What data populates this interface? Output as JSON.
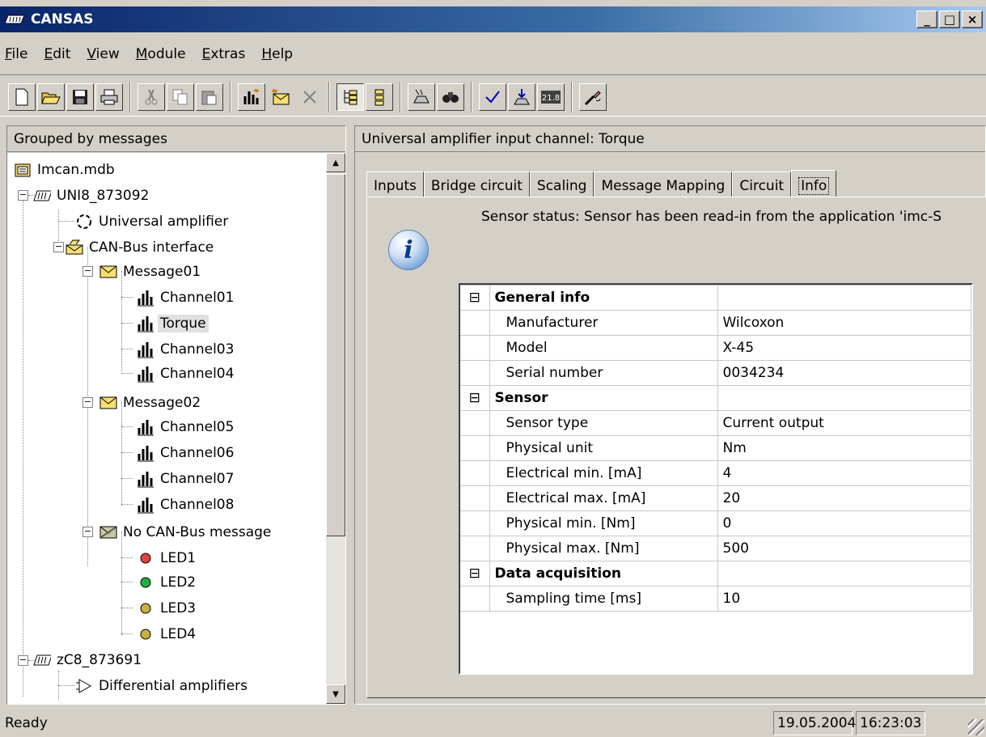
{
  "window": {
    "title": "CANSAS",
    "controls": {
      "minimize": "_",
      "maximize": "□",
      "close": "×"
    }
  },
  "menu": [
    {
      "key": "F",
      "rest": "ile"
    },
    {
      "key": "E",
      "rest": "dit"
    },
    {
      "key": "V",
      "rest": "iew"
    },
    {
      "key": "M",
      "rest": "odule"
    },
    {
      "key": "E",
      "rest": "xtras"
    },
    {
      "key": "H",
      "rest": "elp"
    }
  ],
  "toolbar": {
    "icons": [
      "new-icon",
      "open-icon",
      "save-icon",
      "print-icon",
      "cut-icon",
      "copy-icon",
      "paste-icon",
      "add-channel-icon",
      "add-message-icon",
      "delete-icon",
      "tree-view-icon",
      "list-view-icon",
      "integrate-icon",
      "find-icon",
      "check-icon",
      "download-icon",
      "measure-icon",
      "properties-icon"
    ]
  },
  "left_pane": {
    "header": "Grouped by messages",
    "tree": [
      {
        "label": "Imcan.mdb",
        "icon": "database-icon",
        "expander": ""
      },
      {
        "label": "UNI8_873092",
        "icon": "module-icon",
        "expander": "−"
      },
      {
        "label": "Universal amplifier",
        "icon": "amplifier-icon",
        "expander": ""
      },
      {
        "label": "CAN-Bus interface",
        "icon": "canbus-icon",
        "expander": "−"
      },
      {
        "label": "Message01",
        "icon": "message-icon",
        "expander": "−"
      },
      {
        "label": "Channel01",
        "icon": "channel-icon",
        "expander": ""
      },
      {
        "label": "Torque",
        "icon": "channel-icon",
        "expander": "",
        "selected": true
      },
      {
        "label": "Channel03",
        "icon": "channel-icon",
        "expander": ""
      },
      {
        "label": "Channel04",
        "icon": "channel-icon",
        "expander": ""
      },
      {
        "label": "Message02",
        "icon": "message-icon",
        "expander": "−"
      },
      {
        "label": "Channel05",
        "icon": "channel-icon",
        "expander": ""
      },
      {
        "label": "Channel06",
        "icon": "channel-icon",
        "expander": ""
      },
      {
        "label": "Channel07",
        "icon": "channel-icon",
        "expander": ""
      },
      {
        "label": "Channel08",
        "icon": "channel-icon",
        "expander": ""
      },
      {
        "label": "No CAN-Bus message",
        "icon": "no-message-icon",
        "expander": "−"
      },
      {
        "label": "LED1",
        "icon": "led-red-icon",
        "expander": ""
      },
      {
        "label": "LED2",
        "icon": "led-green-icon",
        "expander": ""
      },
      {
        "label": "LED3",
        "icon": "led-yellow-icon",
        "expander": ""
      },
      {
        "label": "LED4",
        "icon": "led-yellow-icon",
        "expander": ""
      },
      {
        "label": "zC8_873691",
        "icon": "module-icon",
        "expander": "−"
      },
      {
        "label": "Differential amplifiers",
        "icon": "diff-amplifier-icon",
        "expander": ""
      }
    ],
    "scroll_up": "▲",
    "scroll_down": "▼"
  },
  "right_pane": {
    "header": "Universal amplifier input channel: Torque",
    "tabs": [
      "Inputs",
      "Bridge circuit",
      "Scaling",
      "Message Mapping",
      "Circuit",
      "Info"
    ],
    "active_tab": "Info",
    "sensor_status": "Sensor status:  Sensor has been read-in from the application 'imc-S",
    "info_icon_glyph": "i",
    "grid": [
      {
        "type": "category",
        "toggle": "⊟",
        "key": "General info",
        "value": ""
      },
      {
        "type": "prop",
        "key": "Manufacturer",
        "value": "Wilcoxon"
      },
      {
        "type": "prop",
        "key": "Model",
        "value": "X-45"
      },
      {
        "type": "prop",
        "key": "Serial number",
        "value": "0034234"
      },
      {
        "type": "category",
        "toggle": "⊟",
        "key": "Sensor",
        "value": ""
      },
      {
        "type": "prop",
        "key": "Sensor type",
        "value": "Current output"
      },
      {
        "type": "prop",
        "key": "Physical unit",
        "value": "Nm"
      },
      {
        "type": "prop",
        "key": "Electrical min. [mA]",
        "value": "4"
      },
      {
        "type": "prop",
        "key": "Electrical max. [mA]",
        "value": "20"
      },
      {
        "type": "prop",
        "key": "Physical min. [Nm]",
        "value": "0"
      },
      {
        "type": "prop",
        "key": "Physical max. [Nm]",
        "value": "500"
      },
      {
        "type": "category",
        "toggle": "⊟",
        "key": "Data acquisition",
        "value": ""
      },
      {
        "type": "prop",
        "key": "Sampling time [ms]",
        "value": "10"
      }
    ]
  },
  "statusbar": {
    "text": "Ready",
    "date": "19.05.2004",
    "time": "16:23:03"
  },
  "colors": {
    "title_gradient_start": "#0a246a",
    "title_gradient_end": "#a6caf0",
    "face": "#d4d0c8"
  }
}
